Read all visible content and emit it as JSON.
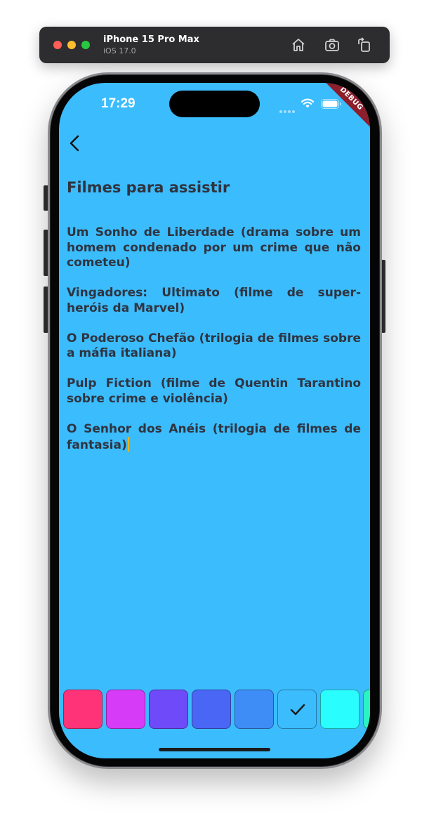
{
  "simulator": {
    "device_name": "iPhone 15 Pro Max",
    "os_version": "iOS 17.0",
    "icons": [
      "home-icon",
      "screenshot-icon",
      "rotate-icon"
    ]
  },
  "status_bar": {
    "time": "17:29",
    "icons": [
      "cellular-signal-icon",
      "wifi-icon",
      "battery-icon"
    ]
  },
  "debug_banner": "DEBUG",
  "note": {
    "title": "Filmes para assistir",
    "paragraphs": [
      "Um Sonho de Liberdade (drama sobre um homem condenado por um crime que não cometeu)",
      "Vingadores: Ultimato (filme de super-heróis da Marvel)",
      "O Poderoso Chefão (trilogia de filmes sobre a máfia italiana)",
      "Pulp Fiction (filme de Quentin Tarantino sobre crime e violência)",
      "O Senhor dos Anéis (trilogia de filmes de fantasia)"
    ]
  },
  "palette": {
    "colors": [
      "#ff3378",
      "#d63bf7",
      "#6f4af8",
      "#4a66f5",
      "#3e8cf6",
      "#3bbcfd",
      "#2afdfd",
      "#2af5c2"
    ],
    "selected_index": 5
  },
  "theme": {
    "background": "#3bbcfd",
    "text": "#2f3440",
    "caret": "#e8b21f"
  }
}
